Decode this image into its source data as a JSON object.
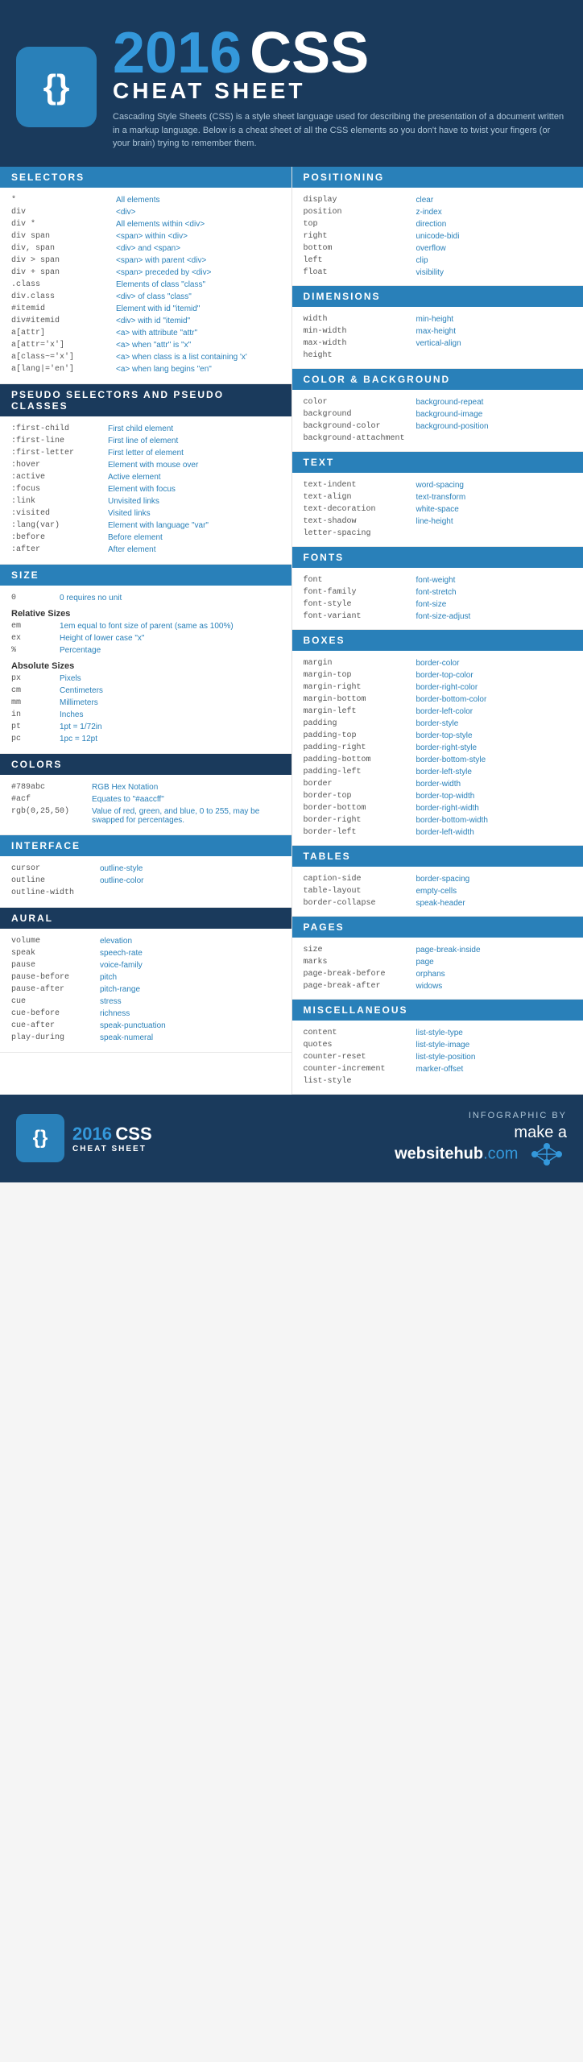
{
  "header": {
    "year": "2016",
    "css_label": "CSS",
    "subtitle": "CHEAT SHEET",
    "logo_icon": "{}",
    "description": "Cascading Style Sheets (CSS) is a style sheet language used for describing the presentation of a document written in a markup language. Below is a cheat sheet of all the CSS elements so you don't have to twist your fingers (or your brain) trying to remember them."
  },
  "selectors": {
    "title": "SELECTORS",
    "items": [
      {
        "code": "*",
        "desc": "All elements"
      },
      {
        "code": "div",
        "desc": "<div>"
      },
      {
        "code": "div *",
        "desc": "All elements within <div>"
      },
      {
        "code": "div span",
        "desc": "<span> within <div>"
      },
      {
        "code": "div, span",
        "desc": "<div> and <span>"
      },
      {
        "code": "div > span",
        "desc": "<span> with parent <div>"
      },
      {
        "code": "div + span",
        "desc": "<span> preceded by <div>"
      },
      {
        "code": ".class",
        "desc": "Elements of class \"class\""
      },
      {
        "code": "div.class",
        "desc": "<div> of class \"class\""
      },
      {
        "code": "#itemid",
        "desc": "Element with id \"itemid\""
      },
      {
        "code": "div#itemid",
        "desc": "<div> with id \"itemid\""
      },
      {
        "code": "a[attr]",
        "desc": "<a> with attribute \"attr\""
      },
      {
        "code": "a[attr='x']",
        "desc": "<a> when \"attr\" is \"x\""
      },
      {
        "code": "a[class~='x']",
        "desc": "<a> when class is a list containing 'x'"
      },
      {
        "code": "a[lang|='en']",
        "desc": "<a> when lang begins \"en\""
      }
    ]
  },
  "pseudo_selectors": {
    "title": "PSEUDO SELECTORS AND PSEUDO CLASSES",
    "items": [
      {
        "code": ":first-child",
        "desc": "First child element"
      },
      {
        "code": ":first-line",
        "desc": "First line of element"
      },
      {
        "code": ":first-letter",
        "desc": "First letter of element"
      },
      {
        "code": ":hover",
        "desc": "Element with mouse over"
      },
      {
        "code": ":active",
        "desc": "Active element"
      },
      {
        "code": ":focus",
        "desc": "Element with focus"
      },
      {
        "code": ":link",
        "desc": "Unvisited links"
      },
      {
        "code": ":visited",
        "desc": "Visited links"
      },
      {
        "code": ":lang(var)",
        "desc": "Element with language \"var\""
      },
      {
        "code": ":before",
        "desc": "Before element"
      },
      {
        "code": ":after",
        "desc": "After element"
      }
    ]
  },
  "size": {
    "title": "SIZE",
    "zero": {
      "code": "0",
      "desc": "0 requires no unit"
    },
    "relative_label": "Relative Sizes",
    "relative": [
      {
        "code": "em",
        "desc": "1em equal to font size of parent (same as 100%)"
      },
      {
        "code": "ex",
        "desc": "Height of lower case \"x\""
      },
      {
        "code": "%",
        "desc": "Percentage"
      }
    ],
    "absolute_label": "Absolute Sizes",
    "absolute": [
      {
        "code": "px",
        "desc": "Pixels"
      },
      {
        "code": "cm",
        "desc": "Centimeters"
      },
      {
        "code": "mm",
        "desc": "Millimeters"
      },
      {
        "code": "in",
        "desc": "Inches"
      },
      {
        "code": "pt",
        "desc": "1pt = 1/72in"
      },
      {
        "code": "pc",
        "desc": "1pc = 12pt"
      }
    ]
  },
  "colors": {
    "title": "COLORS",
    "items": [
      {
        "code": "#789abc",
        "desc": "RGB Hex Notation"
      },
      {
        "code": "#acf",
        "desc": "Equates to \"#aaccff\""
      },
      {
        "code": "rgb(0,25,50)",
        "desc": "Value of red, green, and blue, 0 to 255, may be swapped for percentages."
      }
    ]
  },
  "interface": {
    "title": "INTERFACE",
    "items": [
      {
        "code": "cursor",
        "desc": "outline-style"
      },
      {
        "code": "outline",
        "desc": "outline-color"
      },
      {
        "code": "outline-width",
        "desc": ""
      }
    ]
  },
  "aural": {
    "title": "AURAL",
    "items": [
      {
        "code": "volume",
        "desc": "elevation"
      },
      {
        "code": "speak",
        "desc": "speech-rate"
      },
      {
        "code": "pause",
        "desc": "voice-family"
      },
      {
        "code": "pause-before",
        "desc": "pitch"
      },
      {
        "code": "pause-after",
        "desc": "pitch-range"
      },
      {
        "code": "cue",
        "desc": "stress"
      },
      {
        "code": "cue-before",
        "desc": "richness"
      },
      {
        "code": "cue-after",
        "desc": "speak-punctuation"
      },
      {
        "code": "play-during",
        "desc": "speak-numeral"
      }
    ]
  },
  "positioning": {
    "title": "POSITIONING",
    "items": [
      {
        "code": "display",
        "desc": "clear"
      },
      {
        "code": "position",
        "desc": "z-index"
      },
      {
        "code": "top",
        "desc": "direction"
      },
      {
        "code": "right",
        "desc": "unicode-bidi"
      },
      {
        "code": "bottom",
        "desc": "overflow"
      },
      {
        "code": "left",
        "desc": "clip"
      },
      {
        "code": "float",
        "desc": "visibility"
      }
    ]
  },
  "dimensions": {
    "title": "DIMENSIONS",
    "items": [
      {
        "code": "width",
        "desc": "min-height"
      },
      {
        "code": "min-width",
        "desc": "max-height"
      },
      {
        "code": "max-width",
        "desc": "vertical-align"
      },
      {
        "code": "height",
        "desc": ""
      }
    ]
  },
  "color_background": {
    "title": "COLOR & BACKGROUND",
    "items": [
      {
        "code": "color",
        "desc": "background-repeat"
      },
      {
        "code": "background",
        "desc": "background-image"
      },
      {
        "code": "background-color",
        "desc": "background-position"
      },
      {
        "code": "background-attachment",
        "desc": ""
      }
    ]
  },
  "text": {
    "title": "TEXT",
    "items": [
      {
        "code": "text-indent",
        "desc": "word-spacing"
      },
      {
        "code": "text-align",
        "desc": "text-transform"
      },
      {
        "code": "text-decoration",
        "desc": "white-space"
      },
      {
        "code": "text-shadow",
        "desc": "line-height"
      },
      {
        "code": "letter-spacing",
        "desc": ""
      }
    ]
  },
  "fonts": {
    "title": "FONTS",
    "items": [
      {
        "code": "font",
        "desc": "font-weight"
      },
      {
        "code": "font-family",
        "desc": "font-stretch"
      },
      {
        "code": "font-style",
        "desc": "font-size"
      },
      {
        "code": "font-variant",
        "desc": "font-size-adjust"
      }
    ]
  },
  "boxes": {
    "title": "BOXES",
    "items": [
      {
        "code": "margin",
        "desc": "border-color"
      },
      {
        "code": "margin-top",
        "desc": "border-top-color"
      },
      {
        "code": "margin-right",
        "desc": "border-right-color"
      },
      {
        "code": "margin-bottom",
        "desc": "border-bottom-color"
      },
      {
        "code": "margin-left",
        "desc": "border-left-color"
      },
      {
        "code": "padding",
        "desc": "border-style"
      },
      {
        "code": "padding-top",
        "desc": "border-top-style"
      },
      {
        "code": "padding-right",
        "desc": "border-right-style"
      },
      {
        "code": "padding-bottom",
        "desc": "border-bottom-style"
      },
      {
        "code": "padding-left",
        "desc": "border-left-style"
      },
      {
        "code": "border",
        "desc": "border-width"
      },
      {
        "code": "border-top",
        "desc": "border-top-width"
      },
      {
        "code": "border-bottom",
        "desc": "border-right-width"
      },
      {
        "code": "border-right",
        "desc": "border-bottom-width"
      },
      {
        "code": "border-left",
        "desc": "border-left-width"
      }
    ]
  },
  "tables": {
    "title": "TABLES",
    "items": [
      {
        "code": "caption-side",
        "desc": "border-spacing"
      },
      {
        "code": "table-layout",
        "desc": "empty-cells"
      },
      {
        "code": "border-collapse",
        "desc": "speak-header"
      }
    ]
  },
  "pages": {
    "title": "PAGES",
    "items": [
      {
        "code": "size",
        "desc": "page-break-inside"
      },
      {
        "code": "marks",
        "desc": "page"
      },
      {
        "code": "page-break-before",
        "desc": "orphans"
      },
      {
        "code": "page-break-after",
        "desc": "widows"
      }
    ]
  },
  "miscellaneous": {
    "title": "MISCELLANEOUS",
    "items": [
      {
        "code": "content",
        "desc": "list-style-type"
      },
      {
        "code": "quotes",
        "desc": "list-style-image"
      },
      {
        "code": "counter-reset",
        "desc": "list-style-position"
      },
      {
        "code": "counter-increment",
        "desc": "marker-offset"
      },
      {
        "code": "list-style",
        "desc": ""
      }
    ]
  },
  "footer": {
    "year": "2016",
    "css": "CSS",
    "subtitle": "CHEAT SHEET",
    "logo_icon": "{}",
    "infographic_by": "INFOGRAPHIC BY",
    "brand_pre": "make a",
    "brand_main": "websitehub",
    "brand_tld": ".com"
  }
}
